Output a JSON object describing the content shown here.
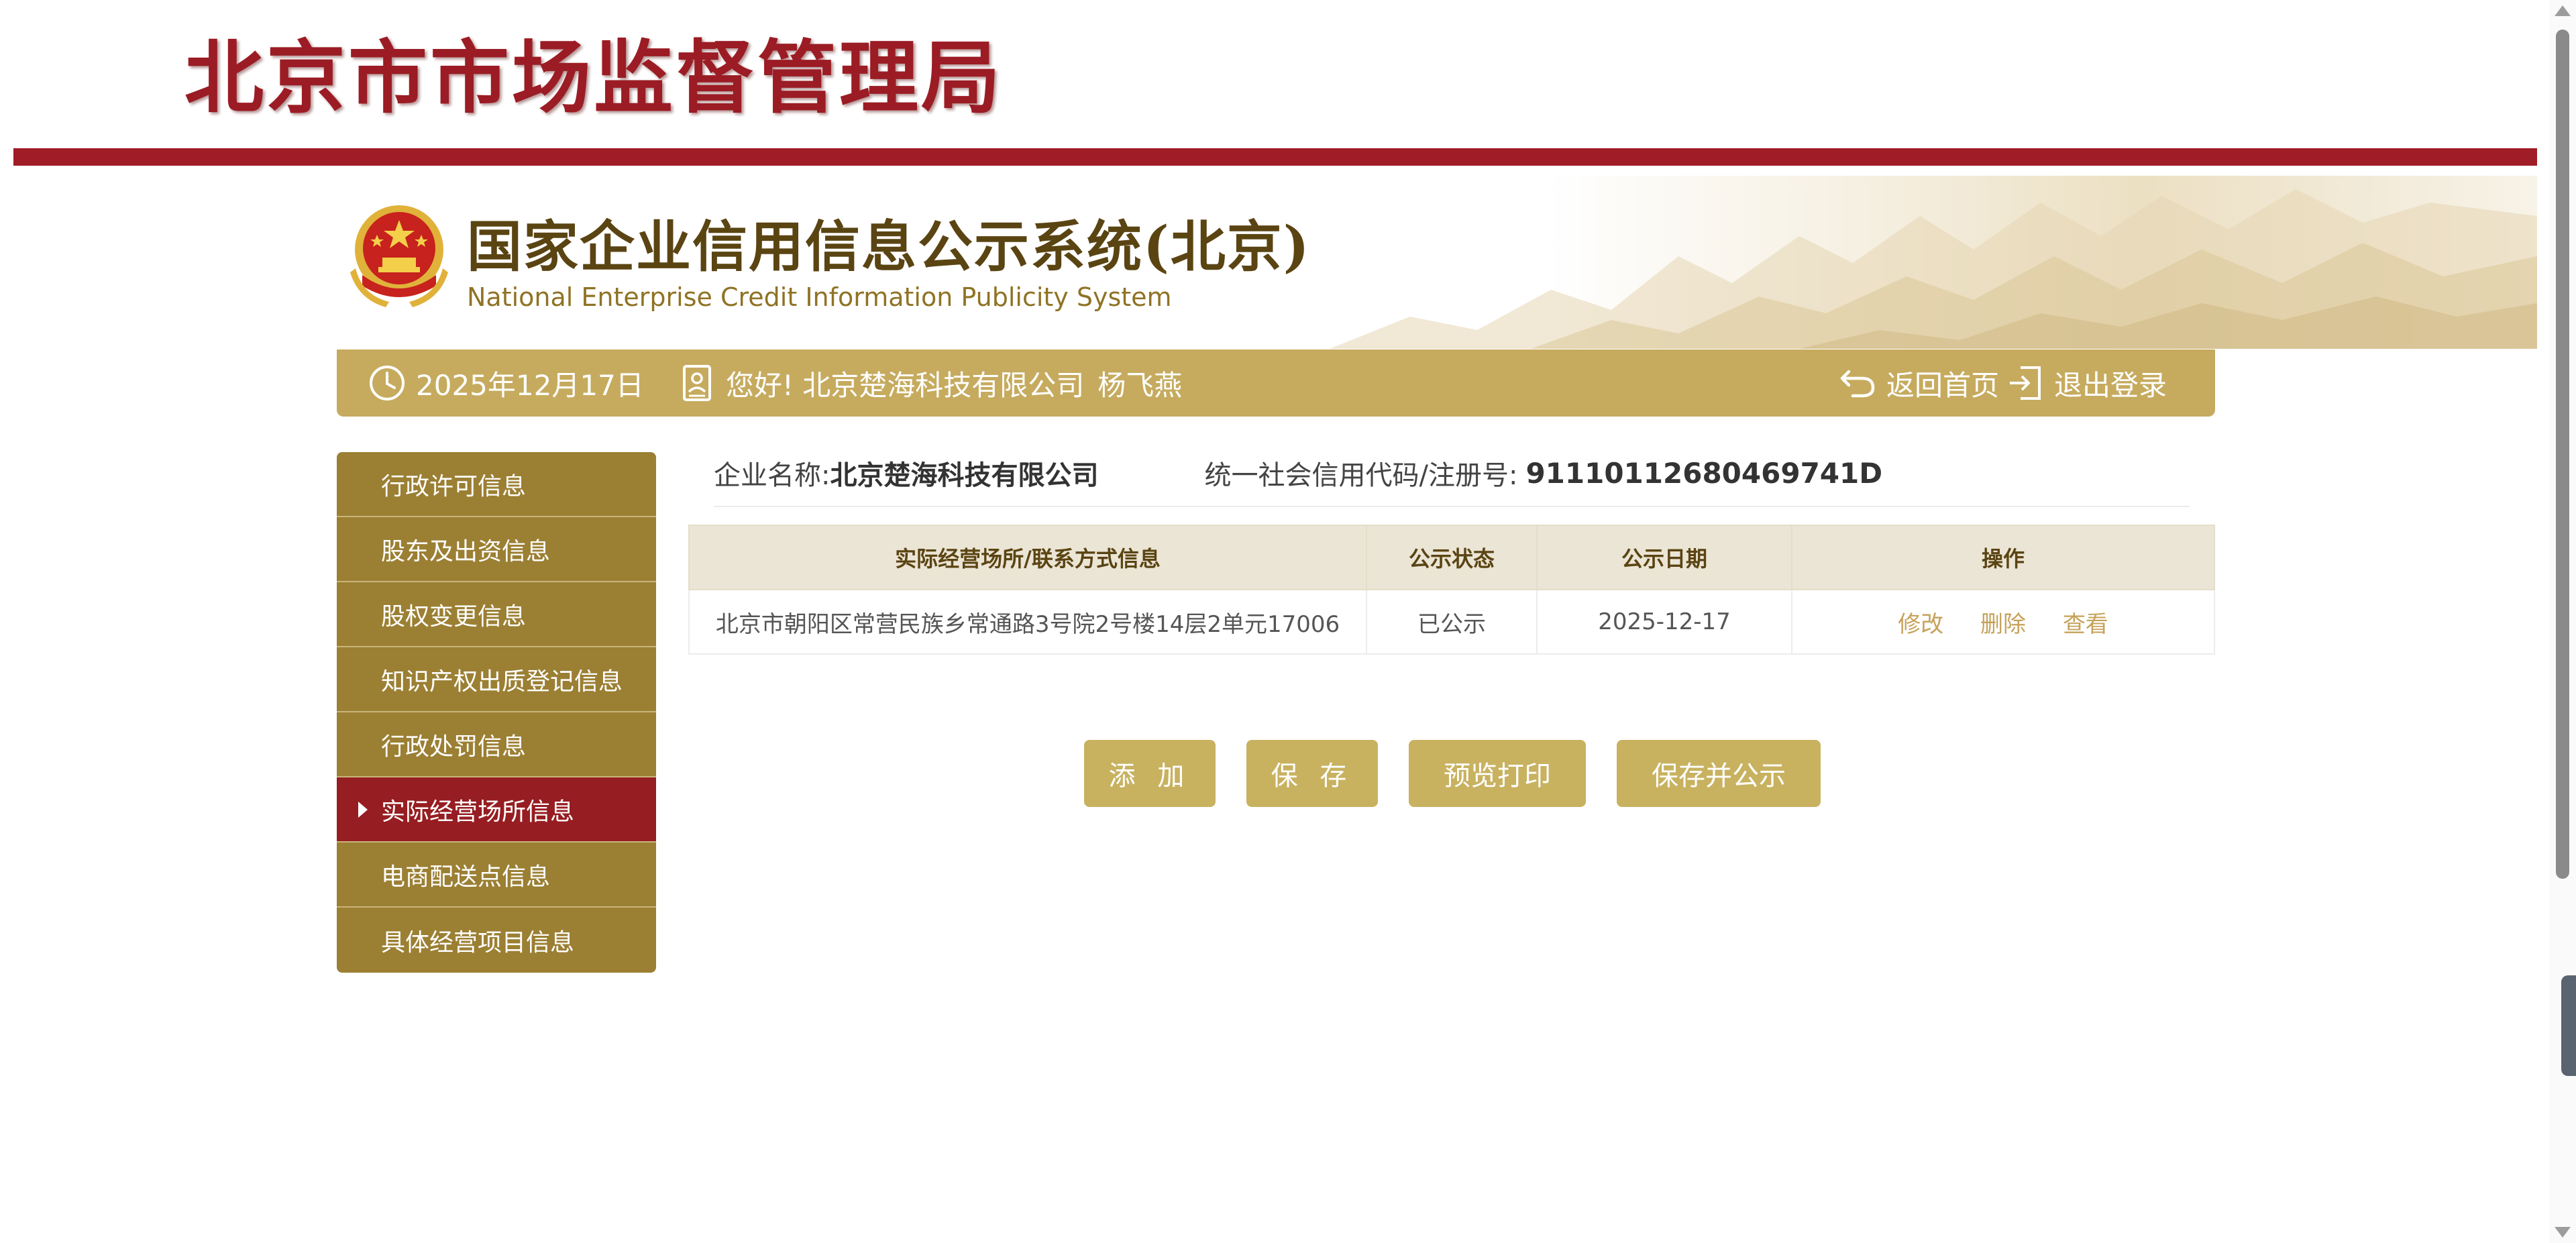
{
  "header": {
    "bureau_title": "北京市市场监督管理局"
  },
  "banner": {
    "title_cn": "国家企业信用信息公示系统(北京)",
    "title_en": "National Enterprise Credit Information Publicity System"
  },
  "info_bar": {
    "date": "2025年12月17日",
    "greeting": "您好!  北京楚海科技有限公司",
    "user_name": "杨飞燕",
    "home_label": "返回首页",
    "logout_label": "退出登录"
  },
  "sidebar": {
    "items": [
      {
        "label": "行政许可信息",
        "active": false
      },
      {
        "label": "股东及出资信息",
        "active": false
      },
      {
        "label": "股权变更信息",
        "active": false
      },
      {
        "label": "知识产权出质登记信息",
        "active": false
      },
      {
        "label": "行政处罚信息",
        "active": false
      },
      {
        "label": "实际经营场所信息",
        "active": true
      },
      {
        "label": "电商配送点信息",
        "active": false
      },
      {
        "label": "具体经营项目信息",
        "active": false
      }
    ]
  },
  "company": {
    "name_label": "企业名称:",
    "name_value": "北京楚海科技有限公司",
    "code_label": "统一社会信用代码/注册号:",
    "code_value": "91110112680469741D"
  },
  "table": {
    "headers": [
      "实际经营场所/联系方式信息",
      "公示状态",
      "公示日期",
      "操作"
    ],
    "rows": [
      {
        "address": "北京市朝阳区常营民族乡常通路3号院2号楼14层2单元17006",
        "status": "已公示",
        "date": "2025-12-17",
        "ops": [
          "修改",
          "删除",
          "查看"
        ]
      }
    ]
  },
  "buttons": {
    "add": "添 加",
    "save": "保 存",
    "preview_print": "预览打印",
    "save_publish": "保存并公示"
  },
  "colors": {
    "brand_red": "#a01c27",
    "gold": "#c6ab5f",
    "sidebar_gold": "#9b7f33",
    "active_red": "#961d21",
    "link_gold": "#c6a25a"
  },
  "icons": {
    "date": "clock-icon",
    "user": "user-badge-icon",
    "home": "return-arrow-icon",
    "logout": "logout-icon",
    "emblem": "national-emblem-icon"
  }
}
